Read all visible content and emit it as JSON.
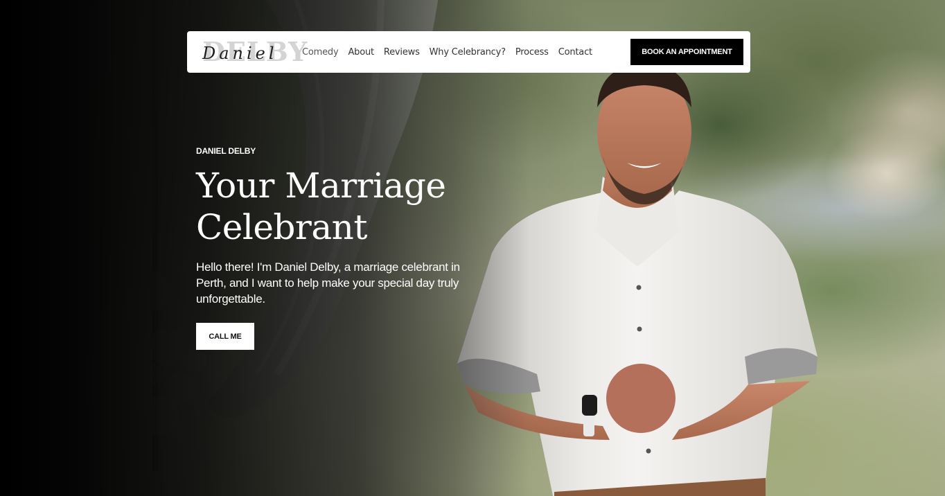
{
  "brand": {
    "logo_block_text": "DELBY",
    "logo_script_text": "Daniel"
  },
  "nav": {
    "items": [
      {
        "label": "Comedy"
      },
      {
        "label": "About"
      },
      {
        "label": "Reviews"
      },
      {
        "label": "Why Celebrancy?"
      },
      {
        "label": "Process"
      },
      {
        "label": "Contact"
      }
    ],
    "cta_label": "BOOK AN APPOINTMENT"
  },
  "hero": {
    "eyebrow": "DANIEL DELBY",
    "title": "Your Marriage Celebrant",
    "lead": "Hello there! I'm Daniel Delby, a marriage celebrant in Perth, and I want to help make your special day truly unforgettable.",
    "cta_label": "CALL ME"
  },
  "colors": {
    "navbar_bg": "#ffffff",
    "cta_dark": "#000000",
    "hero_text": "#ffffff"
  }
}
